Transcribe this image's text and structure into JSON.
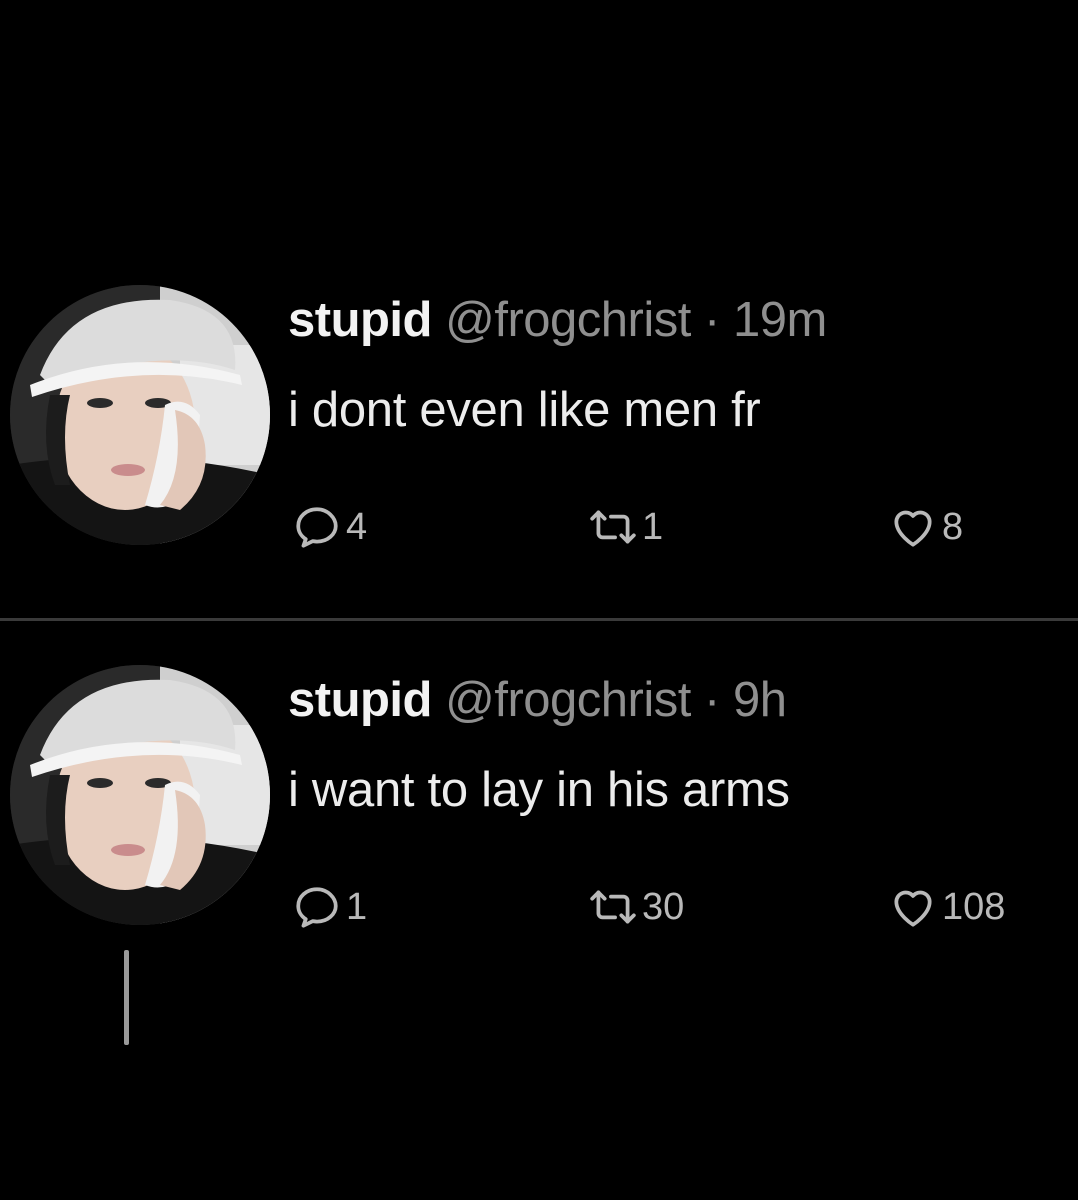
{
  "tweets": [
    {
      "name": "stupid",
      "handle": "@frogchrist",
      "separator": "·",
      "time": "19m",
      "text": "i dont even like men fr",
      "replies": "4",
      "retweets": "1",
      "likes": "8"
    },
    {
      "name": "stupid",
      "handle": "@frogchrist",
      "separator": "·",
      "time": "9h",
      "text": "i want to lay in his arms",
      "replies": "1",
      "retweets": "30",
      "likes": "108"
    }
  ],
  "colors": {
    "background": "#000000",
    "name": "#f2f2f2",
    "meta": "#8f8f8f",
    "icons": "#b9b9b9"
  },
  "icons": {
    "reply": "reply-icon",
    "retweet": "retweet-icon",
    "like": "heart-icon"
  }
}
